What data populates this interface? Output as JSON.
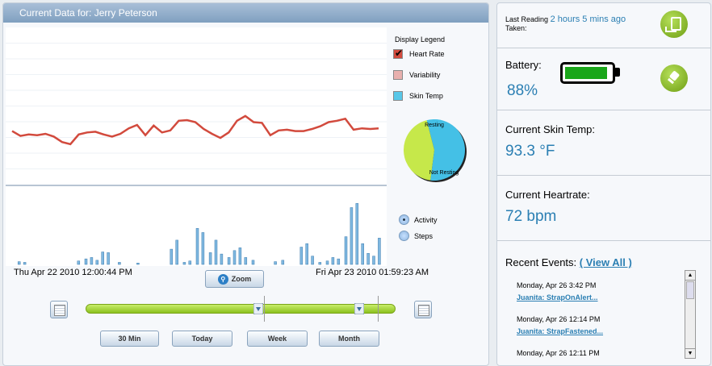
{
  "header": {
    "title_prefix": "Current Data for:",
    "patient_name": "Jerry Peterson"
  },
  "legend": {
    "title": "Display Legend",
    "items": [
      {
        "label": "Heart Rate",
        "checked": true,
        "color": "#d24a3d"
      },
      {
        "label": "Variability",
        "checked": false,
        "color": "#e8b0ae"
      },
      {
        "label": "Skin Temp",
        "checked": false,
        "color": "#58c7e8"
      }
    ]
  },
  "pie": {
    "labels": [
      "Resting",
      "Not Resting"
    ],
    "values": [
      0.56,
      0.44
    ],
    "colors": [
      "#44c0e6",
      "#c6e84a"
    ]
  },
  "activity_options": [
    {
      "label": "Activity",
      "selected": true
    },
    {
      "label": "Steps",
      "selected": false
    }
  ],
  "time_range": {
    "start": "Thu Apr 22 2010 12:00:44 PM",
    "end": "Fri Apr 23 2010 01:59:23 AM"
  },
  "zoom_label": "Zoom",
  "range_buttons": [
    "30 Min",
    "Today",
    "Week",
    "Month"
  ],
  "heart_series": [
    116,
    123,
    121,
    122,
    120,
    124,
    132,
    135,
    121,
    118,
    117,
    121,
    124,
    120,
    112,
    107,
    122,
    108,
    118,
    115,
    101,
    100,
    103,
    113,
    120,
    126,
    118,
    101,
    94,
    103,
    104,
    122,
    115,
    114,
    116,
    116,
    113,
    109,
    103,
    101,
    98,
    114,
    112,
    113,
    112
  ],
  "activity_bars": [
    {
      "x": 0.02,
      "v": 0.04
    },
    {
      "x": 0.035,
      "v": 0.03
    },
    {
      "x": 0.18,
      "v": 0.05
    },
    {
      "x": 0.2,
      "v": 0.08
    },
    {
      "x": 0.215,
      "v": 0.1
    },
    {
      "x": 0.23,
      "v": 0.06
    },
    {
      "x": 0.245,
      "v": 0.18
    },
    {
      "x": 0.26,
      "v": 0.17
    },
    {
      "x": 0.29,
      "v": 0.03
    },
    {
      "x": 0.34,
      "v": 0.02
    },
    {
      "x": 0.43,
      "v": 0.22
    },
    {
      "x": 0.445,
      "v": 0.35
    },
    {
      "x": 0.465,
      "v": 0.03
    },
    {
      "x": 0.48,
      "v": 0.05
    },
    {
      "x": 0.5,
      "v": 0.52
    },
    {
      "x": 0.515,
      "v": 0.46
    },
    {
      "x": 0.535,
      "v": 0.17
    },
    {
      "x": 0.55,
      "v": 0.35
    },
    {
      "x": 0.565,
      "v": 0.15
    },
    {
      "x": 0.585,
      "v": 0.1
    },
    {
      "x": 0.6,
      "v": 0.2
    },
    {
      "x": 0.615,
      "v": 0.24
    },
    {
      "x": 0.63,
      "v": 0.1
    },
    {
      "x": 0.65,
      "v": 0.06
    },
    {
      "x": 0.71,
      "v": 0.04
    },
    {
      "x": 0.73,
      "v": 0.06
    },
    {
      "x": 0.78,
      "v": 0.25
    },
    {
      "x": 0.795,
      "v": 0.3
    },
    {
      "x": 0.81,
      "v": 0.12
    },
    {
      "x": 0.83,
      "v": 0.03
    },
    {
      "x": 0.85,
      "v": 0.05
    },
    {
      "x": 0.865,
      "v": 0.1
    },
    {
      "x": 0.88,
      "v": 0.08
    },
    {
      "x": 0.9,
      "v": 0.4
    },
    {
      "x": 0.915,
      "v": 0.82
    },
    {
      "x": 0.93,
      "v": 0.88
    },
    {
      "x": 0.945,
      "v": 0.3
    },
    {
      "x": 0.96,
      "v": 0.16
    },
    {
      "x": 0.975,
      "v": 0.12
    },
    {
      "x": 0.99,
      "v": 0.38
    }
  ],
  "sidebar": {
    "last_reading_label": "Last Reading",
    "last_reading_value": "2 hours 5 mins ago",
    "taken_label": "Taken:",
    "battery_label": "Battery:",
    "battery_value": "88%",
    "battery_level": 0.88,
    "skin_temp_label": "Current Skin Temp:",
    "skin_temp_value": "93.3 °F",
    "heartrate_label": "Current Heartrate:",
    "heartrate_value": "72 bpm",
    "recent_events_label": "Recent Events:",
    "view_all_label": "( View All )",
    "events": [
      {
        "date": "Monday, Apr 26 3:42 PM",
        "link": "Juanita: StrapOnAlert..."
      },
      {
        "date": "Monday, Apr 26 12:14 PM",
        "link": "Juanita: StrapFastened..."
      },
      {
        "date": "Monday, Apr 26 12:11 PM",
        "link": ""
      }
    ]
  }
}
